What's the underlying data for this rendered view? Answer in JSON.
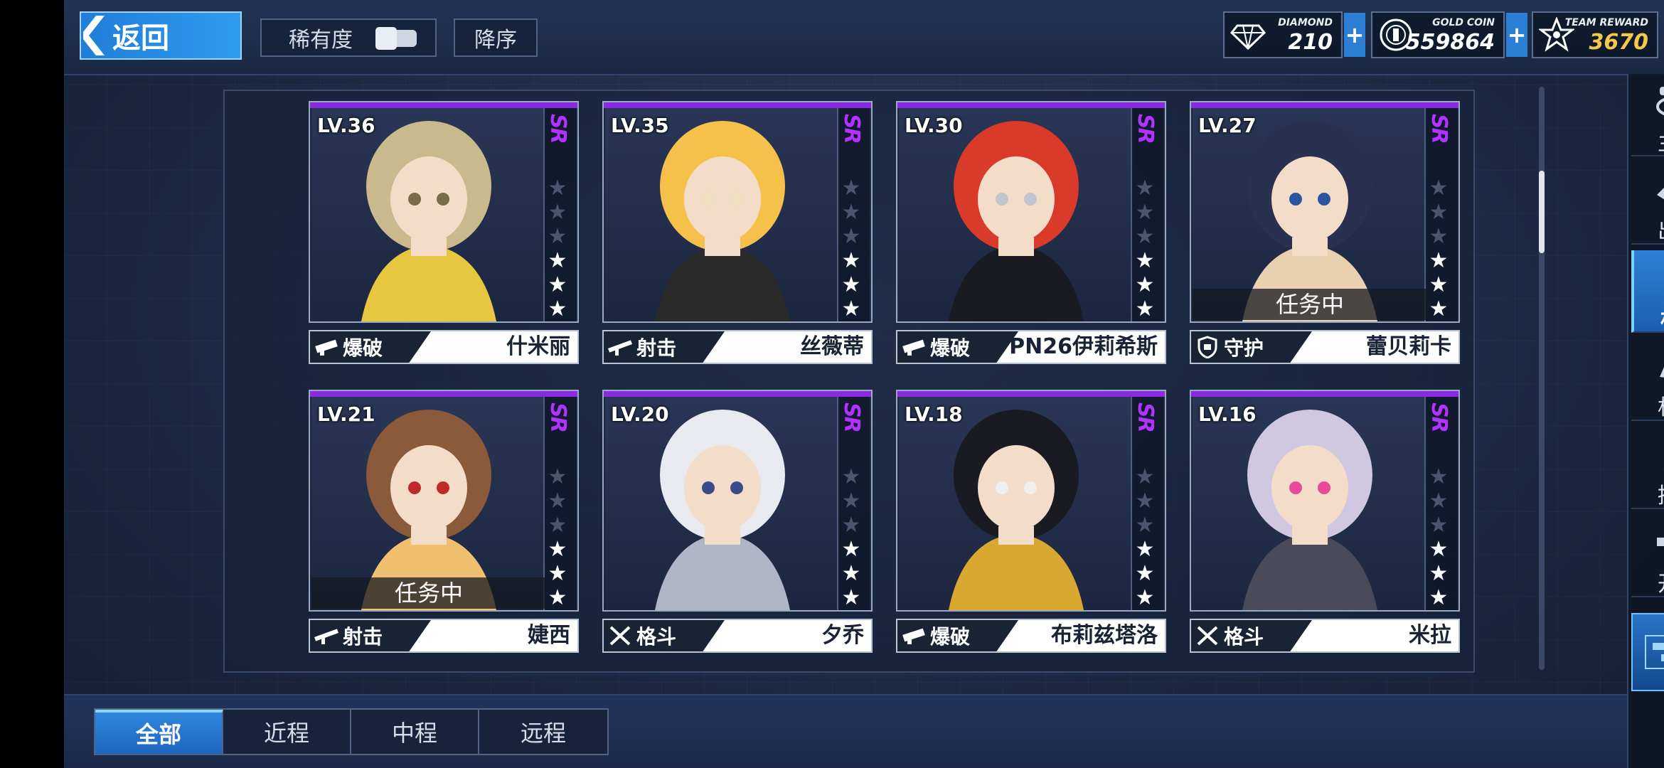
{
  "header": {
    "back_label": "返回",
    "rarity_label": "稀有度",
    "sort_label": "降序"
  },
  "currencies": [
    {
      "name": "DIAMOND",
      "value": "210",
      "icon": "diamond-icon",
      "color": "#ffffff"
    },
    {
      "name": "GOLD COIN",
      "value": "559864",
      "icon": "gold-coin-icon",
      "color": "#ffffff"
    },
    {
      "name": "TEAM REWARD",
      "value": "3670",
      "icon": "team-reward-icon",
      "color": "#f5c84a"
    }
  ],
  "plus_label": "+",
  "cards": [
    {
      "level": "LV.36",
      "rank": "SR",
      "stars": 3,
      "max_stars": 6,
      "role": "爆破",
      "role_icon": "bazooka-icon",
      "name": "什米丽",
      "status": "",
      "colors": [
        "#c9b98c",
        "#e7c640",
        "#7a6c4a"
      ]
    },
    {
      "level": "LV.35",
      "rank": "SR",
      "stars": 3,
      "max_stars": 6,
      "role": "射击",
      "role_icon": "rifle-icon",
      "name": "丝薇蒂",
      "status": "",
      "colors": [
        "#f5c14a",
        "#2a2a2a",
        "#f0e0c0"
      ]
    },
    {
      "level": "LV.30",
      "rank": "SR",
      "stars": 3,
      "max_stars": 6,
      "role": "爆破",
      "role_icon": "bazooka-icon",
      "name": "PN26伊莉希斯",
      "status": "",
      "colors": [
        "#d93a2a",
        "#1a1a22",
        "#c0c4cc"
      ]
    },
    {
      "level": "LV.27",
      "rank": "SR",
      "stars": 3,
      "max_stars": 6,
      "role": "守护",
      "role_icon": "shield-icon",
      "name": "蕾贝莉卡",
      "status": "任务中",
      "colors": [
        "#2a3050",
        "#e8d0b0",
        "#2a56a0"
      ]
    },
    {
      "level": "LV.21",
      "rank": "SR",
      "stars": 3,
      "max_stars": 6,
      "role": "射击",
      "role_icon": "rifle-icon",
      "name": "婕西",
      "status": "任务中",
      "colors": [
        "#8a5a3a",
        "#f0c070",
        "#c02a2a"
      ]
    },
    {
      "level": "LV.20",
      "rank": "SR",
      "stars": 3,
      "max_stars": 6,
      "role": "格斗",
      "role_icon": "crossed-swords-icon",
      "name": "夕乔",
      "status": "",
      "colors": [
        "#e8eaf0",
        "#b0b6c8",
        "#3a4a8a"
      ]
    },
    {
      "level": "LV.18",
      "rank": "SR",
      "stars": 3,
      "max_stars": 6,
      "role": "爆破",
      "role_icon": "bazooka-icon",
      "name": "布莉兹塔洛",
      "status": "",
      "colors": [
        "#1a1a22",
        "#d8a830",
        "#f0f0f0"
      ]
    },
    {
      "level": "LV.16",
      "rank": "SR",
      "stars": 3,
      "max_stars": 6,
      "role": "格斗",
      "role_icon": "crossed-swords-icon",
      "name": "米拉",
      "status": "",
      "colors": [
        "#d0c8e0",
        "#4a4a5a",
        "#e84a9a"
      ]
    }
  ],
  "nav": [
    {
      "label": "主厅",
      "icon": "lobby-icon",
      "active": false
    },
    {
      "label": "出战",
      "icon": "sortie-icon",
      "active": false
    },
    {
      "label": "机师",
      "icon": "pilot-icon",
      "active": true
    },
    {
      "label": "机库",
      "icon": "hangar-icon",
      "active": false
    },
    {
      "label": "招募",
      "icon": "recruit-icon",
      "active": false
    },
    {
      "label": "开发",
      "icon": "develop-icon",
      "active": false
    }
  ],
  "tabs": [
    {
      "label": "全部",
      "active": true
    },
    {
      "label": "近程",
      "active": false
    },
    {
      "label": "中程",
      "active": false
    },
    {
      "label": "远程",
      "active": false
    }
  ],
  "theme": {
    "accent": "#2f86e0",
    "rank_color": "#b233ff",
    "card_topline": "#8a2be2"
  }
}
